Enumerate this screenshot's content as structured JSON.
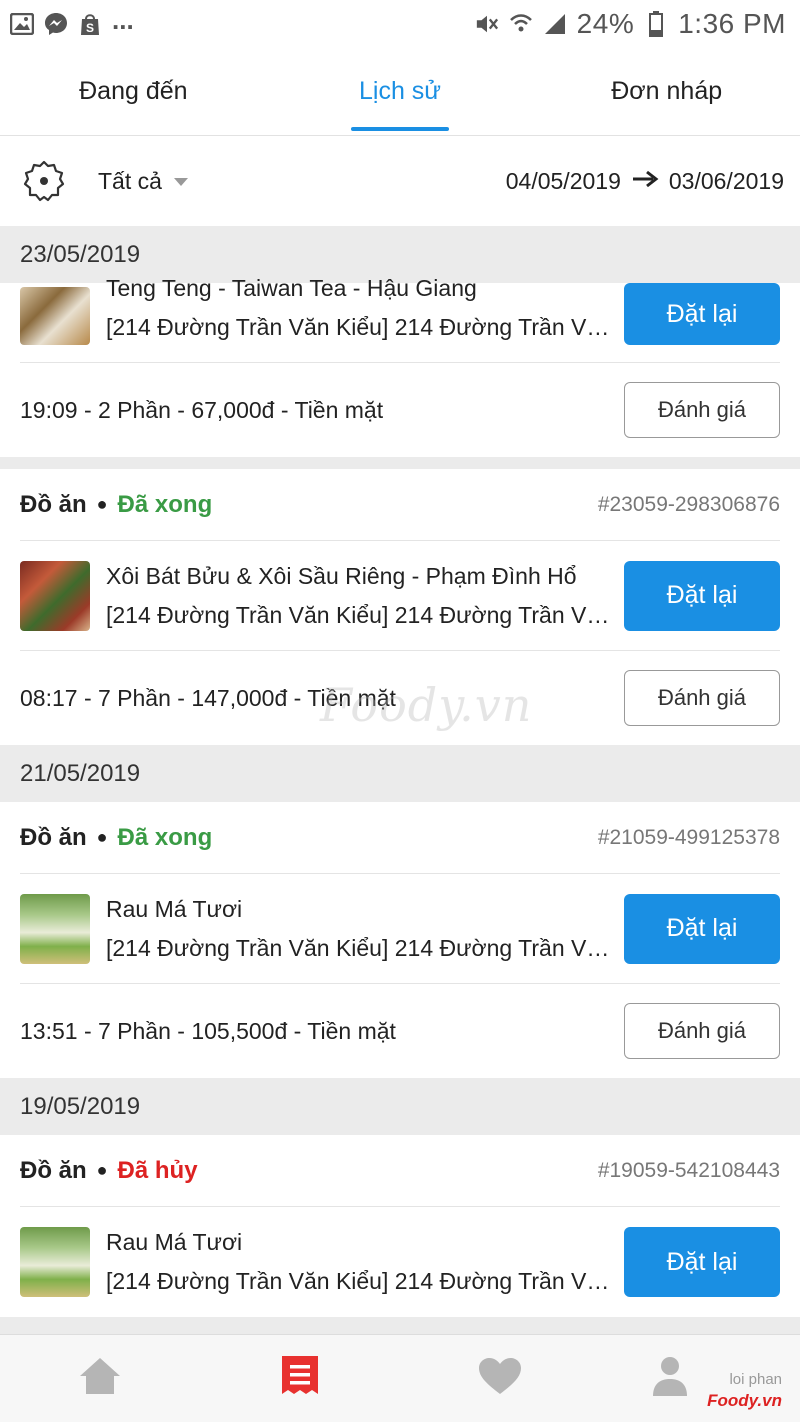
{
  "status_bar": {
    "battery": "24%",
    "time": "1:36 PM",
    "more": "..."
  },
  "tabs": [
    {
      "label": "Đang đến"
    },
    {
      "label": "Lịch sử"
    },
    {
      "label": "Đơn nháp"
    }
  ],
  "filter": {
    "category": "Tất cả",
    "date_from": "04/05/2019",
    "date_to": "03/06/2019"
  },
  "groups": [
    {
      "date": "23/05/2019",
      "orders": [
        {
          "partial": true,
          "item_name": "Teng Teng - Taiwan Tea - Hậu Giang",
          "address": "[214 Đường Trần Văn Kiểu] 214 Đường Trần Văn Kiểu",
          "reorder_label": "Đặt lại",
          "summary": "19:09 - 2 Phần - 67,000đ - Tiền mặt",
          "rate_label": "Đánh giá"
        },
        {
          "type": "Đồ ăn",
          "status": "Đã xong",
          "code": "#23059-298306876",
          "item_name": "Xôi Bát Bửu & Xôi Sầu Riêng - Phạm Đình Hổ",
          "address": "[214 Đường Trần Văn Kiểu] 214 Đường Trần Văn Kiểu",
          "reorder_label": "Đặt lại",
          "summary": "08:17 - 7 Phần - 147,000đ - Tiền mặt",
          "rate_label": "Đánh giá"
        }
      ]
    },
    {
      "date": "21/05/2019",
      "orders": [
        {
          "type": "Đồ ăn",
          "status": "Đã xong",
          "code": "#21059-499125378",
          "item_name": "Rau Má Tươi",
          "address": "[214 Đường Trần Văn Kiểu] 214 Đường Trần Văn Kiểu",
          "reorder_label": "Đặt lại",
          "summary": "13:51 - 7 Phần - 105,500đ - Tiền mặt",
          "rate_label": "Đánh giá"
        }
      ]
    },
    {
      "date": "19/05/2019",
      "orders": [
        {
          "type": "Đồ ăn",
          "status": "Đã hủy",
          "code": "#19059-542108443",
          "item_name": "Rau Má Tươi",
          "address": "[214 Đường Trần Văn Kiểu] 214 Đường Trần Văn Kiểu",
          "reorder_label": "Đặt lại"
        }
      ]
    }
  ],
  "watermark": "Foody.vn",
  "bottom_nav": {
    "user_name": "loi phan",
    "brand": "Foody.vn"
  },
  "colors": {
    "accent": "#1a8fe3",
    "done": "#3a9b45",
    "cancel": "#dd2222",
    "active_nav": "#e8312f"
  }
}
